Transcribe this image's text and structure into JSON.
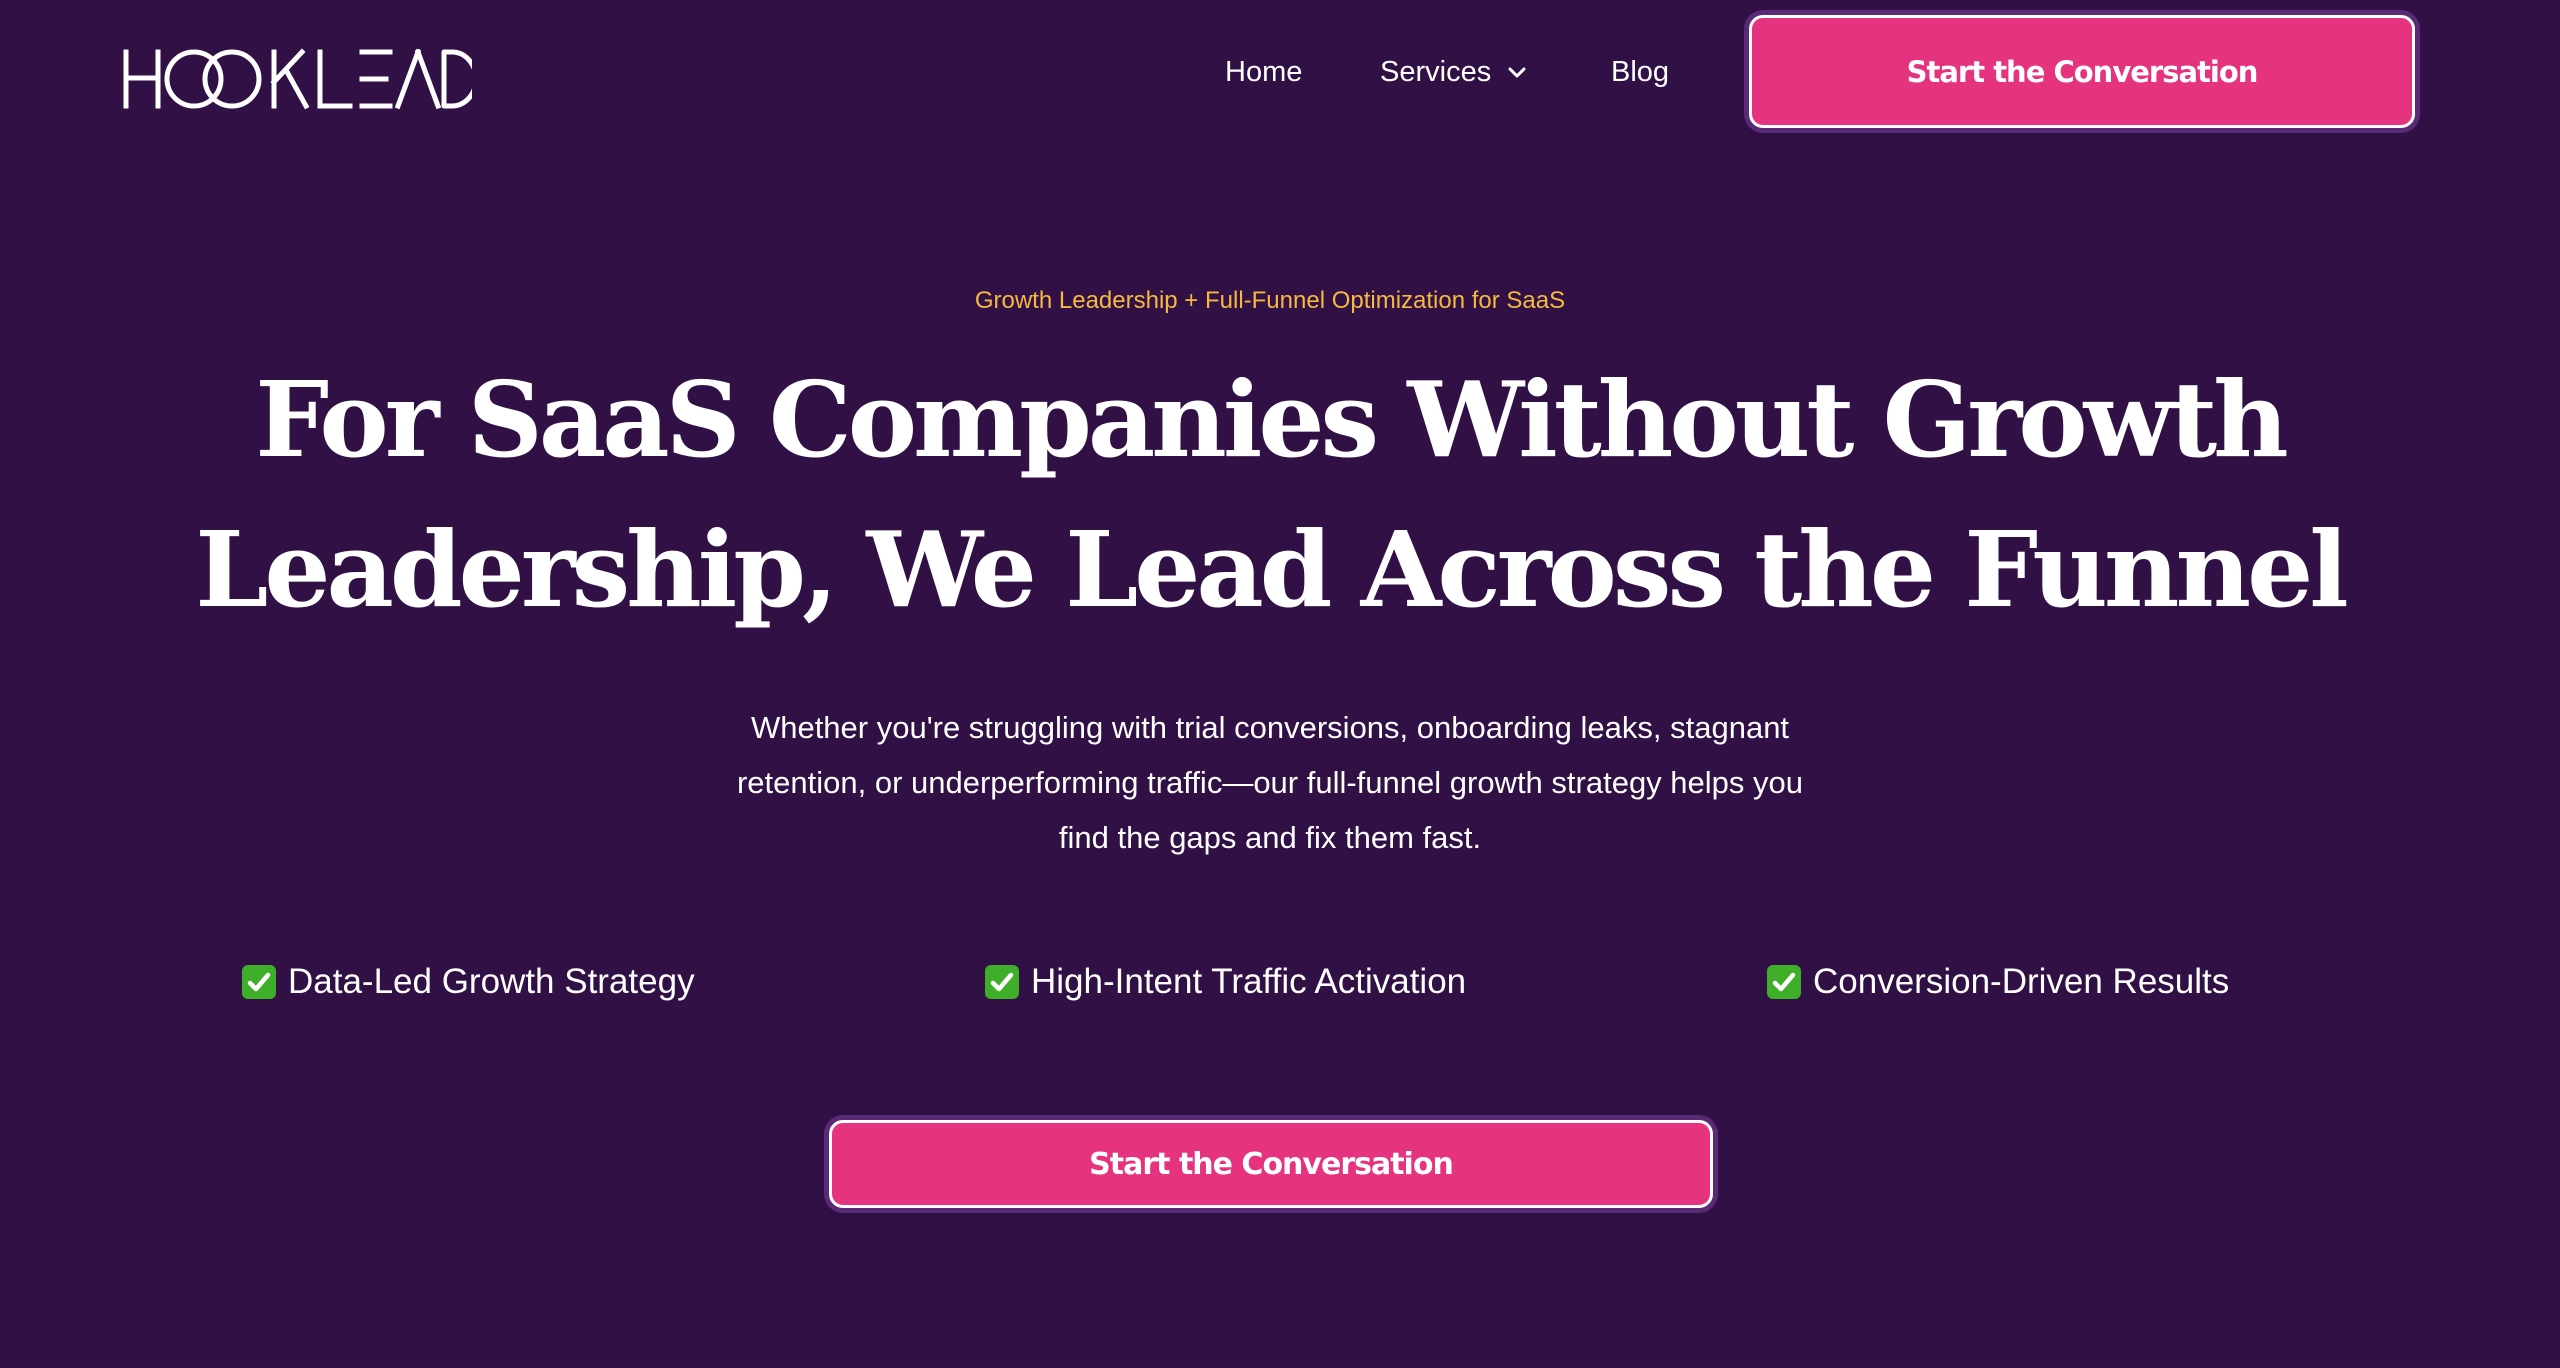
{
  "header": {
    "logo_text": "HOOKLEAD",
    "nav": {
      "home": "Home",
      "services": "Services",
      "blog": "Blog"
    },
    "cta_label": "Start the Conversation"
  },
  "hero": {
    "eyebrow": "Growth Leadership + Full-Funnel Optimization for SaaS",
    "headline_lines": [
      "For SaaS Companies Without Growth",
      "Leadership, We Lead Across the Funnel"
    ],
    "subtext_lines": [
      "Whether you're struggling with trial conversions, onboarding leaks, stagnant",
      "retention, or underperforming traffic—our full-funnel growth strategy helps you",
      "find the gaps and fix them fast."
    ],
    "features": [
      {
        "icon": "check-mark-icon",
        "label": "Data-Led Growth Strategy"
      },
      {
        "icon": "check-mark-icon",
        "label": "High-Intent Traffic Activation"
      },
      {
        "icon": "check-mark-icon",
        "label": "Conversion-Driven Results"
      }
    ],
    "cta_label": "Start the Conversation"
  },
  "colors": {
    "background": "#311045",
    "accent": "#e6337f",
    "eyebrow": "#f5b93f",
    "check": "#3fae29",
    "text": "#ffffff"
  }
}
